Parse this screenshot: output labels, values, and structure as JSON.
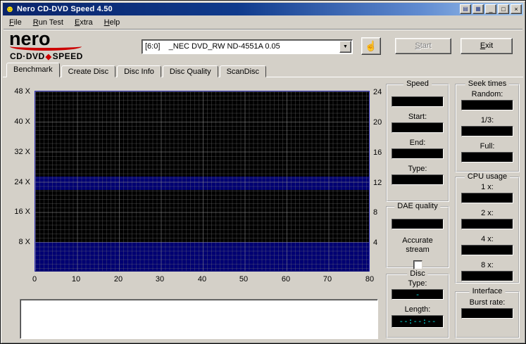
{
  "window": {
    "title": "Nero CD-DVD Speed 4.50",
    "icon_glyph": "☻",
    "controls": {
      "tool1": "▤",
      "tool2": "▦",
      "minimize": "_",
      "maximize": "□",
      "close": "×"
    }
  },
  "menu": {
    "items": [
      "File",
      "Run Test",
      "Extra",
      "Help"
    ]
  },
  "logo": {
    "name": "nero",
    "product_line1": "CD·DVD",
    "diamond": "◆",
    "product_line2": "SPEED"
  },
  "toolbar": {
    "drive_selected": "[6:0]    _NEC DVD_RW ND-4551A 0.05",
    "dropdown_arrow": "▼",
    "hand_icon": "☝",
    "start_label": "Start",
    "exit_label": "Exit"
  },
  "tabs": {
    "items": [
      "Benchmark",
      "Create Disc",
      "Disc Info",
      "Disc Quality",
      "ScanDisc"
    ],
    "active": "Benchmark"
  },
  "chart_data": {
    "type": "line",
    "title": "",
    "series": [],
    "x_ticks": [
      0,
      10,
      20,
      30,
      40,
      50,
      60,
      70,
      80
    ],
    "x_range": [
      0,
      80
    ],
    "y_left_ticks": [
      "48 X",
      "40 X",
      "32 X",
      "24 X",
      "16 X",
      "8 X"
    ],
    "y_left_range": [
      0,
      48
    ],
    "y_right_ticks": [
      24,
      20,
      16,
      12,
      8,
      4
    ],
    "y_right_range": [
      0,
      24
    ],
    "grid": true,
    "highlight_bands": [
      {
        "axis": "left",
        "at": 24
      },
      {
        "axis": "left",
        "from": 0,
        "to": 8
      }
    ]
  },
  "panels": {
    "speed": {
      "title": "Speed",
      "labels": [
        "Start:",
        "End:",
        "Type:"
      ]
    },
    "seek": {
      "title": "Seek times",
      "labels": [
        "Random:",
        "1/3:",
        "Full:"
      ]
    },
    "cpu": {
      "title": "CPU usage",
      "labels": [
        "1 x:",
        "2 x:",
        "4 x:",
        "8 x:"
      ]
    },
    "dae": {
      "title": "DAE quality",
      "accurate_label": "Accurate stream"
    },
    "disc": {
      "title": "Disc",
      "type_label": "Type:",
      "type_value": "-",
      "length_label": "Length:",
      "length_value": "--:--:--"
    },
    "interface": {
      "title": "Interface",
      "label": "Burst rate:"
    }
  },
  "colors": {
    "window_bg": "#d4d0c8",
    "titlebar_left": "#0a246a",
    "titlebar_right": "#a6caf0",
    "chart_bg": "#000000",
    "chart_band_blue": "#000072",
    "chart_frame_blue": "#2d2db8",
    "lcd_text_cyan": "#00e5e5",
    "logo_red": "#cc0000"
  }
}
